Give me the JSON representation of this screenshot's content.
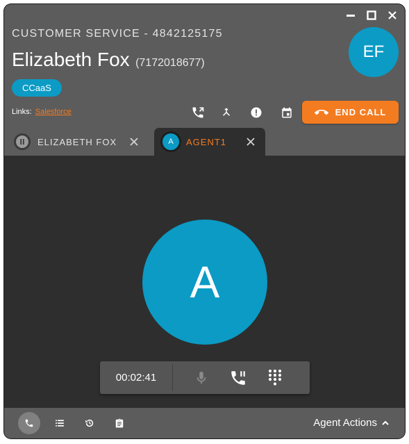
{
  "window": {
    "controls": [
      {
        "icon": "minimize-icon"
      },
      {
        "icon": "maximize-icon"
      },
      {
        "icon": "close-icon"
      }
    ]
  },
  "header": {
    "queue": "CUSTOMER SERVICE - 4842125175",
    "caller_name": "Elizabeth Fox",
    "caller_phone": "(7172018677)",
    "avatar_initials": "EF",
    "tag": "CCaaS",
    "links_label": "Links:",
    "links": [
      {
        "label": "Salesforce"
      }
    ],
    "actions": [
      {
        "icon": "transfer-call-icon"
      },
      {
        "icon": "merge-icon"
      },
      {
        "icon": "alert-icon"
      },
      {
        "icon": "calendar-icon"
      }
    ],
    "end_call_label": "END CALL"
  },
  "tabs": [
    {
      "label": "ELIZABETH FOX",
      "icon": "pause-icon",
      "active": false
    },
    {
      "label": "AGENT1",
      "avatar_initial": "A",
      "active": true
    }
  ],
  "main": {
    "avatar_initial": "A",
    "timer": "00:02:41",
    "controls": [
      {
        "icon": "microphone-icon"
      },
      {
        "icon": "hold-call-icon"
      },
      {
        "icon": "dialpad-icon"
      }
    ]
  },
  "footer": {
    "buttons": [
      {
        "icon": "phone-icon",
        "active": true
      },
      {
        "icon": "list-icon",
        "active": false
      },
      {
        "icon": "history-icon",
        "active": false
      },
      {
        "icon": "clipboard-icon",
        "active": false
      }
    ],
    "agent_actions_label": "Agent Actions"
  },
  "colors": {
    "accent_orange": "#f47c20",
    "accent_blue": "#0b9bc5",
    "header_bg": "#5c5c5c",
    "body_bg": "#2e2e2e"
  }
}
